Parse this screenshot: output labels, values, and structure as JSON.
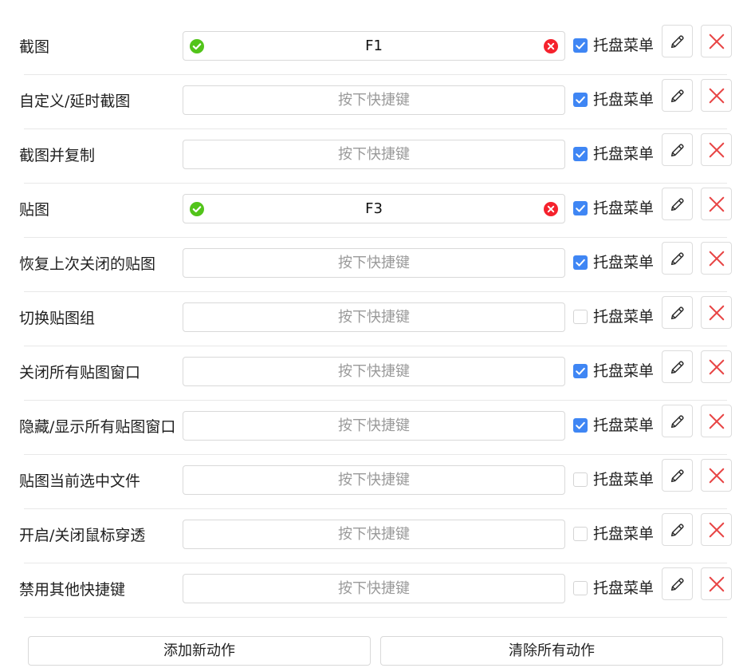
{
  "tray_label": "托盘菜单",
  "hotkey_placeholder": "按下快捷键",
  "colors": {
    "accent": "#3f86f4",
    "ok": "#52c41a",
    "error": "#f5222d",
    "delete_x": "#e84545"
  },
  "actions": [
    {
      "label": "截图",
      "hotkey": "F1",
      "tray": true
    },
    {
      "label": "自定义/延时截图",
      "hotkey": "",
      "tray": true
    },
    {
      "label": "截图并复制",
      "hotkey": "",
      "tray": true
    },
    {
      "label": "贴图",
      "hotkey": "F3",
      "tray": true
    },
    {
      "label": "恢复上次关闭的贴图",
      "hotkey": "",
      "tray": true
    },
    {
      "label": "切换贴图组",
      "hotkey": "",
      "tray": false
    },
    {
      "label": "关闭所有贴图窗口",
      "hotkey": "",
      "tray": true
    },
    {
      "label": "隐藏/显示所有贴图窗口",
      "hotkey": "",
      "tray": true
    },
    {
      "label": "贴图当前选中文件",
      "hotkey": "",
      "tray": false
    },
    {
      "label": "开启/关闭鼠标穿透",
      "hotkey": "",
      "tray": false
    },
    {
      "label": "禁用其他快捷键",
      "hotkey": "",
      "tray": false
    }
  ],
  "buttons": {
    "add_action": "添加新动作",
    "clear_actions": "清除所有动作"
  }
}
